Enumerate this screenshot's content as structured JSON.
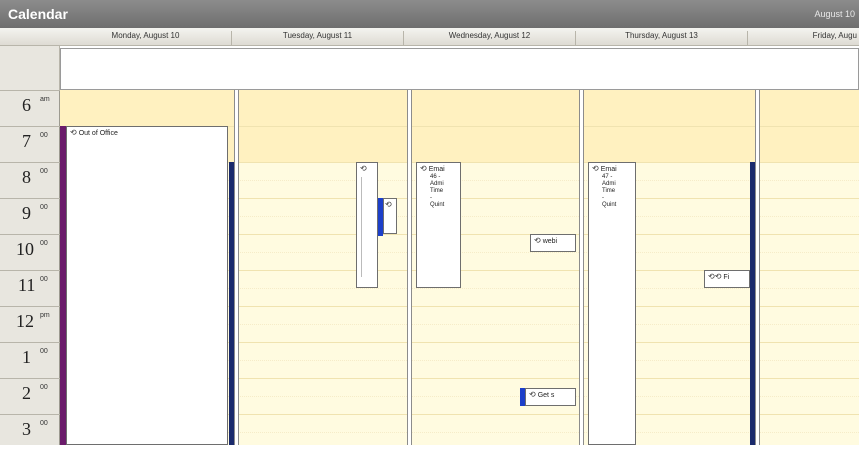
{
  "window": {
    "title": "Calendar",
    "date_range": "August 10"
  },
  "days": [
    {
      "label": "Monday, August 10"
    },
    {
      "label": "Tuesday, August 11"
    },
    {
      "label": "Wednesday, August 12"
    },
    {
      "label": "Thursday, August 13"
    },
    {
      "label": "Friday, Augu"
    }
  ],
  "hours": [
    {
      "num": "6",
      "sup": "am"
    },
    {
      "num": "7",
      "sup": "00"
    },
    {
      "num": "8",
      "sup": "00"
    },
    {
      "num": "9",
      "sup": "00"
    },
    {
      "num": "10",
      "sup": "00"
    },
    {
      "num": "11",
      "sup": "00"
    },
    {
      "num": "12",
      "sup": "pm"
    },
    {
      "num": "1",
      "sup": "00"
    },
    {
      "num": "2",
      "sup": "00"
    },
    {
      "num": "3",
      "sup": "00"
    }
  ],
  "appointments": {
    "out_of_office": {
      "subject": "Out of Office",
      "icon": "recurrence-icon"
    },
    "tue_a": {
      "subject": "",
      "icon": "recurrence-icon"
    },
    "tue_b": {
      "subject": "",
      "icon": "recurrence-icon"
    },
    "wed_email": {
      "subject": "Emai",
      "lines": [
        "46 -",
        "Admi",
        "Time",
        "-",
        "Quint"
      ],
      "icon": "recurrence-icon"
    },
    "wed_web": {
      "subject": "webi",
      "icon": "recurrence-icon"
    },
    "wed_get": {
      "subject": "Get s",
      "icon": "recurrence-icon"
    },
    "thu_email": {
      "subject": "Emai",
      "lines": [
        "47 -",
        "Admi",
        "Time",
        "-",
        "Quint"
      ],
      "icon": "recurrence-icon"
    },
    "thu_fi": {
      "subject": "Fi",
      "icon": "recurrence-icon"
    }
  },
  "colors": {
    "out_of_office": "#6b1b6b",
    "busy": "#1a2a6c",
    "tentative_mark": "#1c3fc9",
    "working_hours": "#fffbe0",
    "off_hours": "#fff1c0"
  }
}
